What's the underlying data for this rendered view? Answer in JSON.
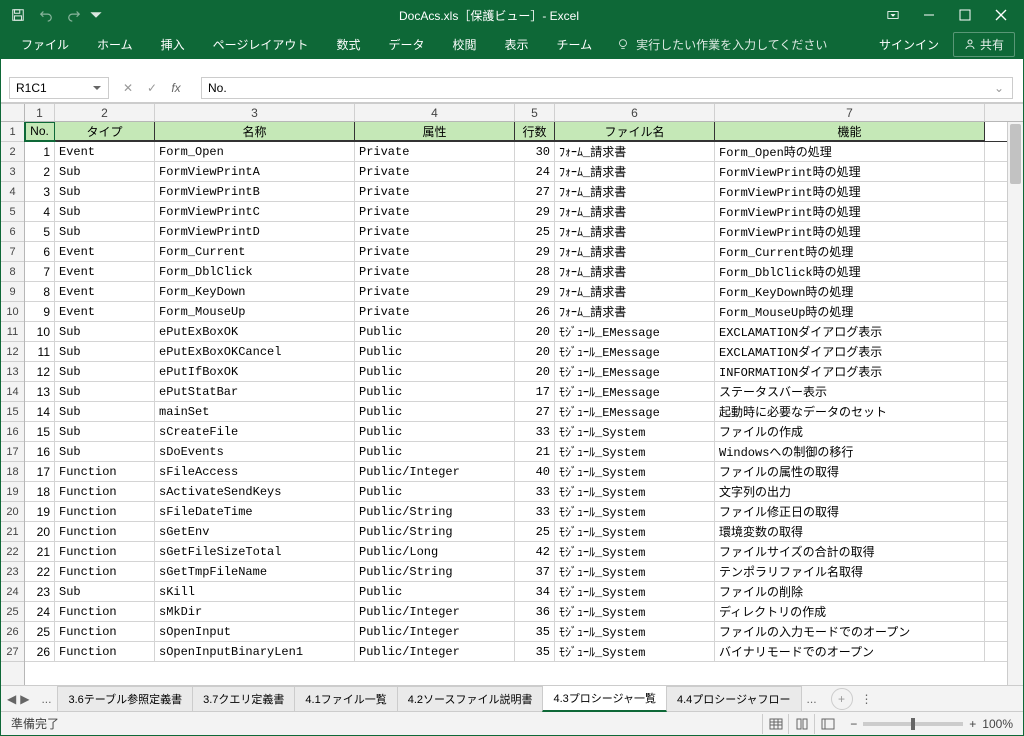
{
  "title": "DocAcs.xls［保護ビュー］- Excel",
  "ribbon": {
    "file": "ファイル",
    "home": "ホーム",
    "insert": "挿入",
    "layout": "ページレイアウト",
    "formulas": "数式",
    "data": "データ",
    "review": "校閲",
    "view": "表示",
    "team": "チーム",
    "tellme": "実行したい作業を入力してください",
    "signin": "サインイン",
    "share": "共有"
  },
  "namebox": "R1C1",
  "formula": "No.",
  "cols": [
    "1",
    "2",
    "3",
    "4",
    "5",
    "6",
    "7"
  ],
  "headers": {
    "no": "No.",
    "type": "タイプ",
    "name": "名称",
    "attr": "属性",
    "lines": "行数",
    "file": "ファイル名",
    "func": "機能"
  },
  "rows": [
    {
      "n": "1",
      "t": "Event",
      "nm": "Form_Open",
      "a": "Private",
      "l": "30",
      "f": "ﾌｫｰﾑ_請求書",
      "fn": "Form_Open時の処理"
    },
    {
      "n": "2",
      "t": "Sub",
      "nm": "FormViewPrintA",
      "a": "Private",
      "l": "24",
      "f": "ﾌｫｰﾑ_請求書",
      "fn": "FormViewPrint時の処理"
    },
    {
      "n": "3",
      "t": "Sub",
      "nm": "FormViewPrintB",
      "a": "Private",
      "l": "27",
      "f": "ﾌｫｰﾑ_請求書",
      "fn": "FormViewPrint時の処理"
    },
    {
      "n": "4",
      "t": "Sub",
      "nm": "FormViewPrintC",
      "a": "Private",
      "l": "29",
      "f": "ﾌｫｰﾑ_請求書",
      "fn": "FormViewPrint時の処理"
    },
    {
      "n": "5",
      "t": "Sub",
      "nm": "FormViewPrintD",
      "a": "Private",
      "l": "25",
      "f": "ﾌｫｰﾑ_請求書",
      "fn": "FormViewPrint時の処理"
    },
    {
      "n": "6",
      "t": "Event",
      "nm": "Form_Current",
      "a": "Private",
      "l": "29",
      "f": "ﾌｫｰﾑ_請求書",
      "fn": "Form_Current時の処理"
    },
    {
      "n": "7",
      "t": "Event",
      "nm": "Form_DblClick",
      "a": "Private",
      "l": "28",
      "f": "ﾌｫｰﾑ_請求書",
      "fn": "Form_DblClick時の処理"
    },
    {
      "n": "8",
      "t": "Event",
      "nm": "Form_KeyDown",
      "a": "Private",
      "l": "29",
      "f": "ﾌｫｰﾑ_請求書",
      "fn": "Form_KeyDown時の処理"
    },
    {
      "n": "9",
      "t": "Event",
      "nm": "Form_MouseUp",
      "a": "Private",
      "l": "26",
      "f": "ﾌｫｰﾑ_請求書",
      "fn": "Form_MouseUp時の処理"
    },
    {
      "n": "10",
      "t": "Sub",
      "nm": "ePutExBoxOK",
      "a": "Public",
      "l": "20",
      "f": "ﾓｼﾞｭｰﾙ_EMessage",
      "fn": "EXCLAMATIONダイアログ表示"
    },
    {
      "n": "11",
      "t": "Sub",
      "nm": "ePutExBoxOKCancel",
      "a": "Public",
      "l": "20",
      "f": "ﾓｼﾞｭｰﾙ_EMessage",
      "fn": "EXCLAMATIONダイアログ表示"
    },
    {
      "n": "12",
      "t": "Sub",
      "nm": "ePutIfBoxOK",
      "a": "Public",
      "l": "20",
      "f": "ﾓｼﾞｭｰﾙ_EMessage",
      "fn": "INFORMATIONダイアログ表示"
    },
    {
      "n": "13",
      "t": "Sub",
      "nm": "ePutStatBar",
      "a": "Public",
      "l": "17",
      "f": "ﾓｼﾞｭｰﾙ_EMessage",
      "fn": "ステータスバー表示"
    },
    {
      "n": "14",
      "t": "Sub",
      "nm": "mainSet",
      "a": "Public",
      "l": "27",
      "f": "ﾓｼﾞｭｰﾙ_EMessage",
      "fn": "起動時に必要なデータのセット"
    },
    {
      "n": "15",
      "t": "Sub",
      "nm": "sCreateFile",
      "a": "Public",
      "l": "33",
      "f": "ﾓｼﾞｭｰﾙ_System",
      "fn": "ファイルの作成"
    },
    {
      "n": "16",
      "t": "Sub",
      "nm": "sDoEvents",
      "a": "Public",
      "l": "21",
      "f": "ﾓｼﾞｭｰﾙ_System",
      "fn": "Windowsへの制御の移行"
    },
    {
      "n": "17",
      "t": "Function",
      "nm": "sFileAccess",
      "a": "Public/Integer",
      "l": "40",
      "f": "ﾓｼﾞｭｰﾙ_System",
      "fn": "ファイルの属性の取得"
    },
    {
      "n": "18",
      "t": "Function",
      "nm": "sActivateSendKeys",
      "a": "Public",
      "l": "33",
      "f": "ﾓｼﾞｭｰﾙ_System",
      "fn": "文字列の出力"
    },
    {
      "n": "19",
      "t": "Function",
      "nm": "sFileDateTime",
      "a": "Public/String",
      "l": "33",
      "f": "ﾓｼﾞｭｰﾙ_System",
      "fn": "ファイル修正日の取得"
    },
    {
      "n": "20",
      "t": "Function",
      "nm": "sGetEnv",
      "a": "Public/String",
      "l": "25",
      "f": "ﾓｼﾞｭｰﾙ_System",
      "fn": "環境変数の取得"
    },
    {
      "n": "21",
      "t": "Function",
      "nm": "sGetFileSizeTotal",
      "a": "Public/Long",
      "l": "42",
      "f": "ﾓｼﾞｭｰﾙ_System",
      "fn": "ファイルサイズの合計の取得"
    },
    {
      "n": "22",
      "t": "Function",
      "nm": "sGetTmpFileName",
      "a": "Public/String",
      "l": "37",
      "f": "ﾓｼﾞｭｰﾙ_System",
      "fn": "テンポラリファイル名取得"
    },
    {
      "n": "23",
      "t": "Sub",
      "nm": "sKill",
      "a": "Public",
      "l": "34",
      "f": "ﾓｼﾞｭｰﾙ_System",
      "fn": "ファイルの削除"
    },
    {
      "n": "24",
      "t": "Function",
      "nm": "sMkDir",
      "a": "Public/Integer",
      "l": "36",
      "f": "ﾓｼﾞｭｰﾙ_System",
      "fn": "ディレクトリの作成"
    },
    {
      "n": "25",
      "t": "Function",
      "nm": "sOpenInput",
      "a": "Public/Integer",
      "l": "35",
      "f": "ﾓｼﾞｭｰﾙ_System",
      "fn": "ファイルの入力モードでのオープン"
    },
    {
      "n": "26",
      "t": "Function",
      "nm": "sOpenInputBinaryLen1",
      "a": "Public/Integer",
      "l": "35",
      "f": "ﾓｼﾞｭｰﾙ_System",
      "fn": "バイナリモードでのオープン"
    }
  ],
  "tabs": {
    "more_l": "...",
    "t1": "3.6テーブル参照定義書",
    "t2": "3.7クエリ定義書",
    "t3": "4.1ファイル一覧",
    "t4": "4.2ソースファイル説明書",
    "t5": "4.3プロシージャ一覧",
    "t6": "4.4プロシージャフロー",
    "more_r": "..."
  },
  "status": {
    "ready": "準備完了",
    "zoom": "100%"
  }
}
